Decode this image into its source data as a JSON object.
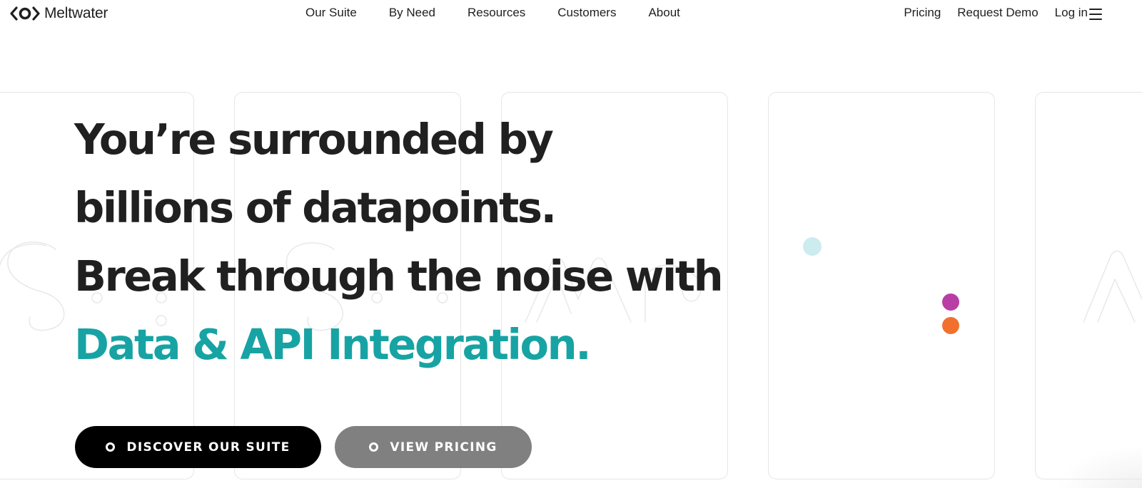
{
  "brand": {
    "name": "Meltwater",
    "logo_icon": "meltwater-logo-icon"
  },
  "nav": {
    "center": [
      {
        "label": "Our Suite"
      },
      {
        "label": "By Need"
      },
      {
        "label": "Resources"
      },
      {
        "label": "Customers"
      },
      {
        "label": "About"
      }
    ],
    "right": [
      {
        "label": "Pricing"
      },
      {
        "label": "Request Demo"
      },
      {
        "label": "Log in"
      }
    ],
    "menu_icon": "hamburger-menu-icon"
  },
  "hero": {
    "lines": [
      "You’re surrounded by",
      "billions of datapoints.",
      "Break through the noise with",
      "Data & API Integration."
    ]
  },
  "cta": {
    "primary": {
      "label": "DISCOVER OUR SUITE",
      "icon": "ring-icon"
    },
    "secondary": {
      "label": "VIEW PRICING",
      "icon": "ring-icon"
    }
  },
  "colors": {
    "accent": "#17a3a3",
    "text": "#202020",
    "primary_button": "#000000",
    "secondary_button": "#808080",
    "dot_light": "#cdecef",
    "dot_magenta": "#b83ea6",
    "dot_orange": "#f2702d",
    "card_border": "#e6e6e6"
  }
}
